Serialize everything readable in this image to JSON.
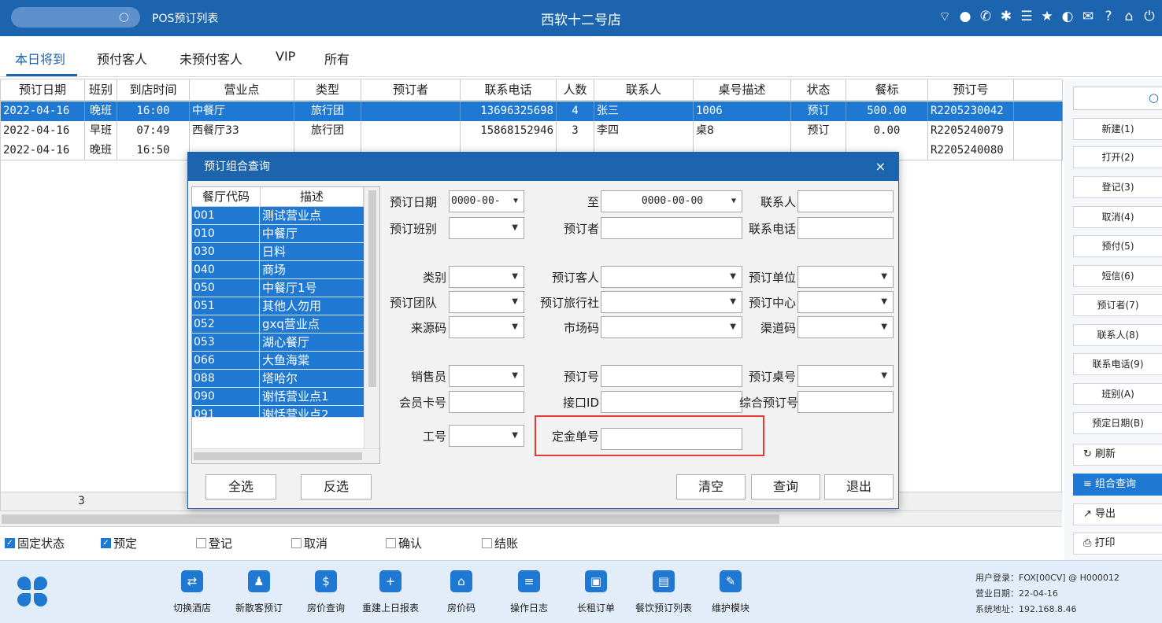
{
  "topbar": {
    "app_title": "POS预订列表",
    "store_name": "西软十二号店",
    "icons": [
      "wifi-icon",
      "chat-icon",
      "phone-icon",
      "palette-icon",
      "menu-icon",
      "star-icon",
      "contrast-icon",
      "mail-icon",
      "help-icon",
      "home-icon",
      "power-icon"
    ]
  },
  "tabs": [
    "本日将到",
    "预付客人",
    "未预付客人",
    "VIP",
    "所有"
  ],
  "table": {
    "columns": [
      "预订日期",
      "班别",
      "到店时间",
      "营业点",
      "类型",
      "预订者",
      "联系电话",
      "人数",
      "联系人",
      "桌号描述",
      "状态",
      "餐标",
      "预订号"
    ],
    "rows": [
      {
        "date": "2022-04-16",
        "shift": "晚班",
        "time": "16:00",
        "outlet": "中餐厅",
        "type": "旅行团",
        "booker": "",
        "phone": "13696325698",
        "people": "4",
        "contact": "张三",
        "table": "1006",
        "status": "预订",
        "std": "500.00",
        "no": "R2205230042"
      },
      {
        "date": "2022-04-16",
        "shift": "早班",
        "time": "07:49",
        "outlet": "西餐厅33",
        "type": "旅行团",
        "booker": "",
        "phone": "15868152946",
        "people": "3",
        "contact": "李四",
        "table": "桌8",
        "status": "预订",
        "std": "0.00",
        "no": "R2205240079"
      },
      {
        "date": "2022-04-16",
        "shift": "晚班",
        "time": "16:50",
        "outlet": "",
        "type": "",
        "booker": "",
        "phone": "",
        "people": "",
        "contact": "",
        "table": "",
        "status": "",
        "std": "",
        "no": "R2205240080"
      }
    ],
    "count": "3"
  },
  "filters": [
    {
      "label": "固定状态",
      "checked": true
    },
    {
      "label": "预定",
      "checked": true
    },
    {
      "label": "登记",
      "checked": false
    },
    {
      "label": "取消",
      "checked": false
    },
    {
      "label": "确认",
      "checked": false
    },
    {
      "label": "结账",
      "checked": false
    }
  ],
  "right_panel": {
    "buttons": [
      "新建(1)",
      "打开(2)",
      "登记(3)",
      "取消(4)",
      "预付(5)",
      "短信(6)",
      "预订者(7)",
      "联系人(8)",
      "联系电话(9)",
      "班别(A)",
      "预定日期(B)"
    ],
    "tools": [
      {
        "icon": "↻",
        "label": "刷新"
      },
      {
        "icon": "≡",
        "label": "组合查询"
      },
      {
        "icon": "↗",
        "label": "导出"
      },
      {
        "icon": "⎙",
        "label": "打印"
      }
    ]
  },
  "bottombar": {
    "items": [
      {
        "icon": "⇄",
        "label": "切换酒店"
      },
      {
        "icon": "♟",
        "label": "新散客预订"
      },
      {
        "icon": "$",
        "label": "房价查询"
      },
      {
        "icon": "+",
        "label": "重建上日报表"
      },
      {
        "icon": "⌂",
        "label": "房价码"
      },
      {
        "icon": "≡",
        "label": "操作日志"
      },
      {
        "icon": "▣",
        "label": "长租订单"
      },
      {
        "icon": "▤",
        "label": "餐饮预订列表"
      },
      {
        "icon": "✎",
        "label": "维护模块"
      }
    ],
    "user_login": "用户登录：FOX[00CV] @ H000012",
    "business_date": "营业日期：22-04-16",
    "system_address": "系统地址：192.168.8.46"
  },
  "dialog": {
    "title": "预订组合查询",
    "close": "×",
    "list": {
      "headers": [
        "餐厅代码",
        "描述"
      ],
      "rows": [
        [
          "001",
          "测试营业点"
        ],
        [
          "010",
          "中餐厅"
        ],
        [
          "030",
          "日料"
        ],
        [
          "040",
          "商场"
        ],
        [
          "050",
          "中餐厅1号"
        ],
        [
          "051",
          "其他人勿用"
        ],
        [
          "052",
          "gxq营业点"
        ],
        [
          "053",
          "湖心餐厅"
        ],
        [
          "066",
          "大鱼海棠"
        ],
        [
          "088",
          "塔哈尔"
        ],
        [
          "090",
          "谢恬营业点1"
        ],
        [
          "091",
          "谢恬营业点2"
        ]
      ]
    },
    "fields": {
      "date_from_label": "预订日期",
      "date_from_value": "0000-00-",
      "date_to_label": "至",
      "date_to_value": "0000-00-00",
      "contact_label": "联系人",
      "shift_label": "预订班别",
      "booker_label": "预订者",
      "phone_label": "联系电话",
      "category_label": "类别",
      "guest_label": "预订客人",
      "company_label": "预订单位",
      "team_label": "预订团队",
      "agency_label": "预订旅行社",
      "center_label": "预订中心",
      "source_label": "来源码",
      "market_label": "市场码",
      "channel_label": "渠道码",
      "sales_label": "销售员",
      "resno_label": "预订号",
      "tableno_label": "预订桌号",
      "member_label": "会员卡号",
      "api_label": "接口ID",
      "combo_label": "综合预订号",
      "staff_label": "工号",
      "deposit_label": "定金单号"
    },
    "buttons": {
      "select_all": "全选",
      "invert": "反选",
      "clear": "清空",
      "query": "查询",
      "exit": "退出"
    }
  }
}
